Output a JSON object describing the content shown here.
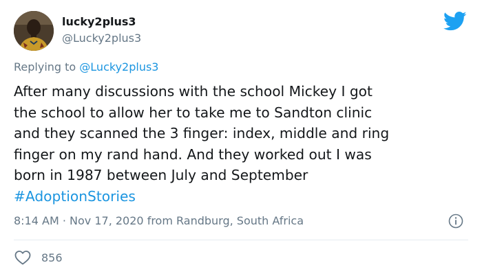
{
  "author": {
    "display_name": "lucky2plus3",
    "handle": "@Lucky2plus3"
  },
  "reply": {
    "prefix": "Replying to",
    "mention": "@Lucky2plus3"
  },
  "tweet": {
    "lines": [
      "After many discussions with the school Mickey I got",
      "the school to allow her to take me to Sandton clinic",
      "and they scanned the 3 finger: index, middle and ring",
      "finger on my rand hand. And they worked out I was",
      "born in 1987 between July and September"
    ],
    "hashtag": "#AdoptionStories"
  },
  "meta": {
    "time": "8:14 AM · Nov 17, 2020",
    "location": "from Randburg, South Africa"
  },
  "engagement": {
    "likes": "856"
  },
  "icons": {
    "brand": "twitter-bird-icon",
    "info": "info-icon",
    "like": "heart-icon"
  },
  "colors": {
    "accent": "#1da1f2",
    "link": "#1b95e0",
    "secondary_text": "#657786",
    "primary_text": "#14171a"
  }
}
